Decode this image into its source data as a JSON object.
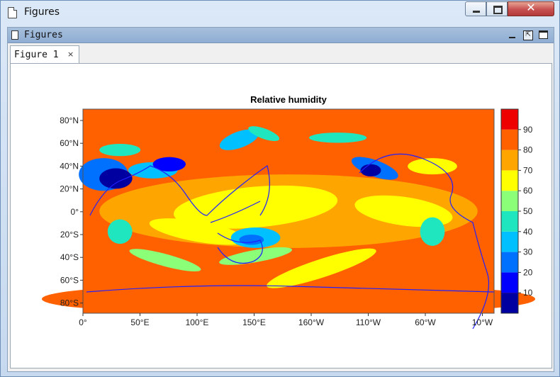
{
  "window": {
    "title": "Figures",
    "close_glyph": "✕"
  },
  "panel": {
    "title": "Figures",
    "undock_glyph": "⇱"
  },
  "tabs": [
    {
      "label": "Figure 1",
      "close_glyph": "×"
    }
  ],
  "chart_data": {
    "type": "heatmap",
    "title": "Relative humidity",
    "xlabel": "",
    "ylabel": "",
    "x_ticks": [
      "0°",
      "50°E",
      "100°E",
      "150°E",
      "160°W",
      "110°W",
      "60°W",
      "10°W"
    ],
    "y_ticks": [
      "80°N",
      "60°N",
      "40°N",
      "20°N",
      "0°",
      "20°S",
      "40°S",
      "60°S",
      "80°S"
    ],
    "colorbar": {
      "levels": [
        10,
        20,
        30,
        40,
        50,
        60,
        70,
        80,
        90
      ],
      "colors": [
        "#0000a0",
        "#0000ff",
        "#0070ff",
        "#00c0ff",
        "#20e6c0",
        "#8cff78",
        "#ffff00",
        "#ffa500",
        "#ff6000",
        "#ee0000"
      ]
    },
    "coastline_color": "#2020ff"
  }
}
